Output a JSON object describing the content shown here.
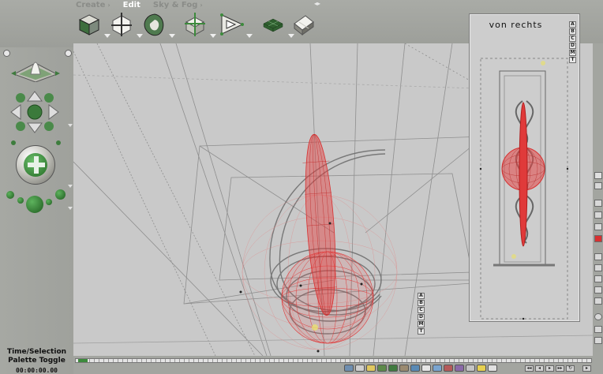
{
  "menu": {
    "tabs": [
      {
        "label": "Create",
        "active": false
      },
      {
        "label": "Edit",
        "active": true
      },
      {
        "label": "Sky & Fog",
        "active": false
      }
    ]
  },
  "toolbar": {
    "tools": [
      "create-cube-icon",
      "create-sphere-icon",
      "create-torus-icon",
      "create-cone-icon",
      "create-pyramid-icon",
      "create-terrain-icon",
      "create-plane-icon"
    ]
  },
  "camera_inset": {
    "title": "von rechts",
    "controls": [
      "A",
      "B",
      "C",
      "D",
      "M",
      "T"
    ]
  },
  "viewport_controls": [
    "A",
    "B",
    "C",
    "D",
    "M",
    "T"
  ],
  "time_palette": {
    "label_line1": "Time/Selection",
    "label_line2": "Palette Toggle",
    "timecode": "00:00:00.00"
  },
  "colors": {
    "accent": "#3c8a3c",
    "model_red": "#e03a3a",
    "panel_bg": "#a3a5a0",
    "viewport_bg": "#c9c9c9"
  }
}
